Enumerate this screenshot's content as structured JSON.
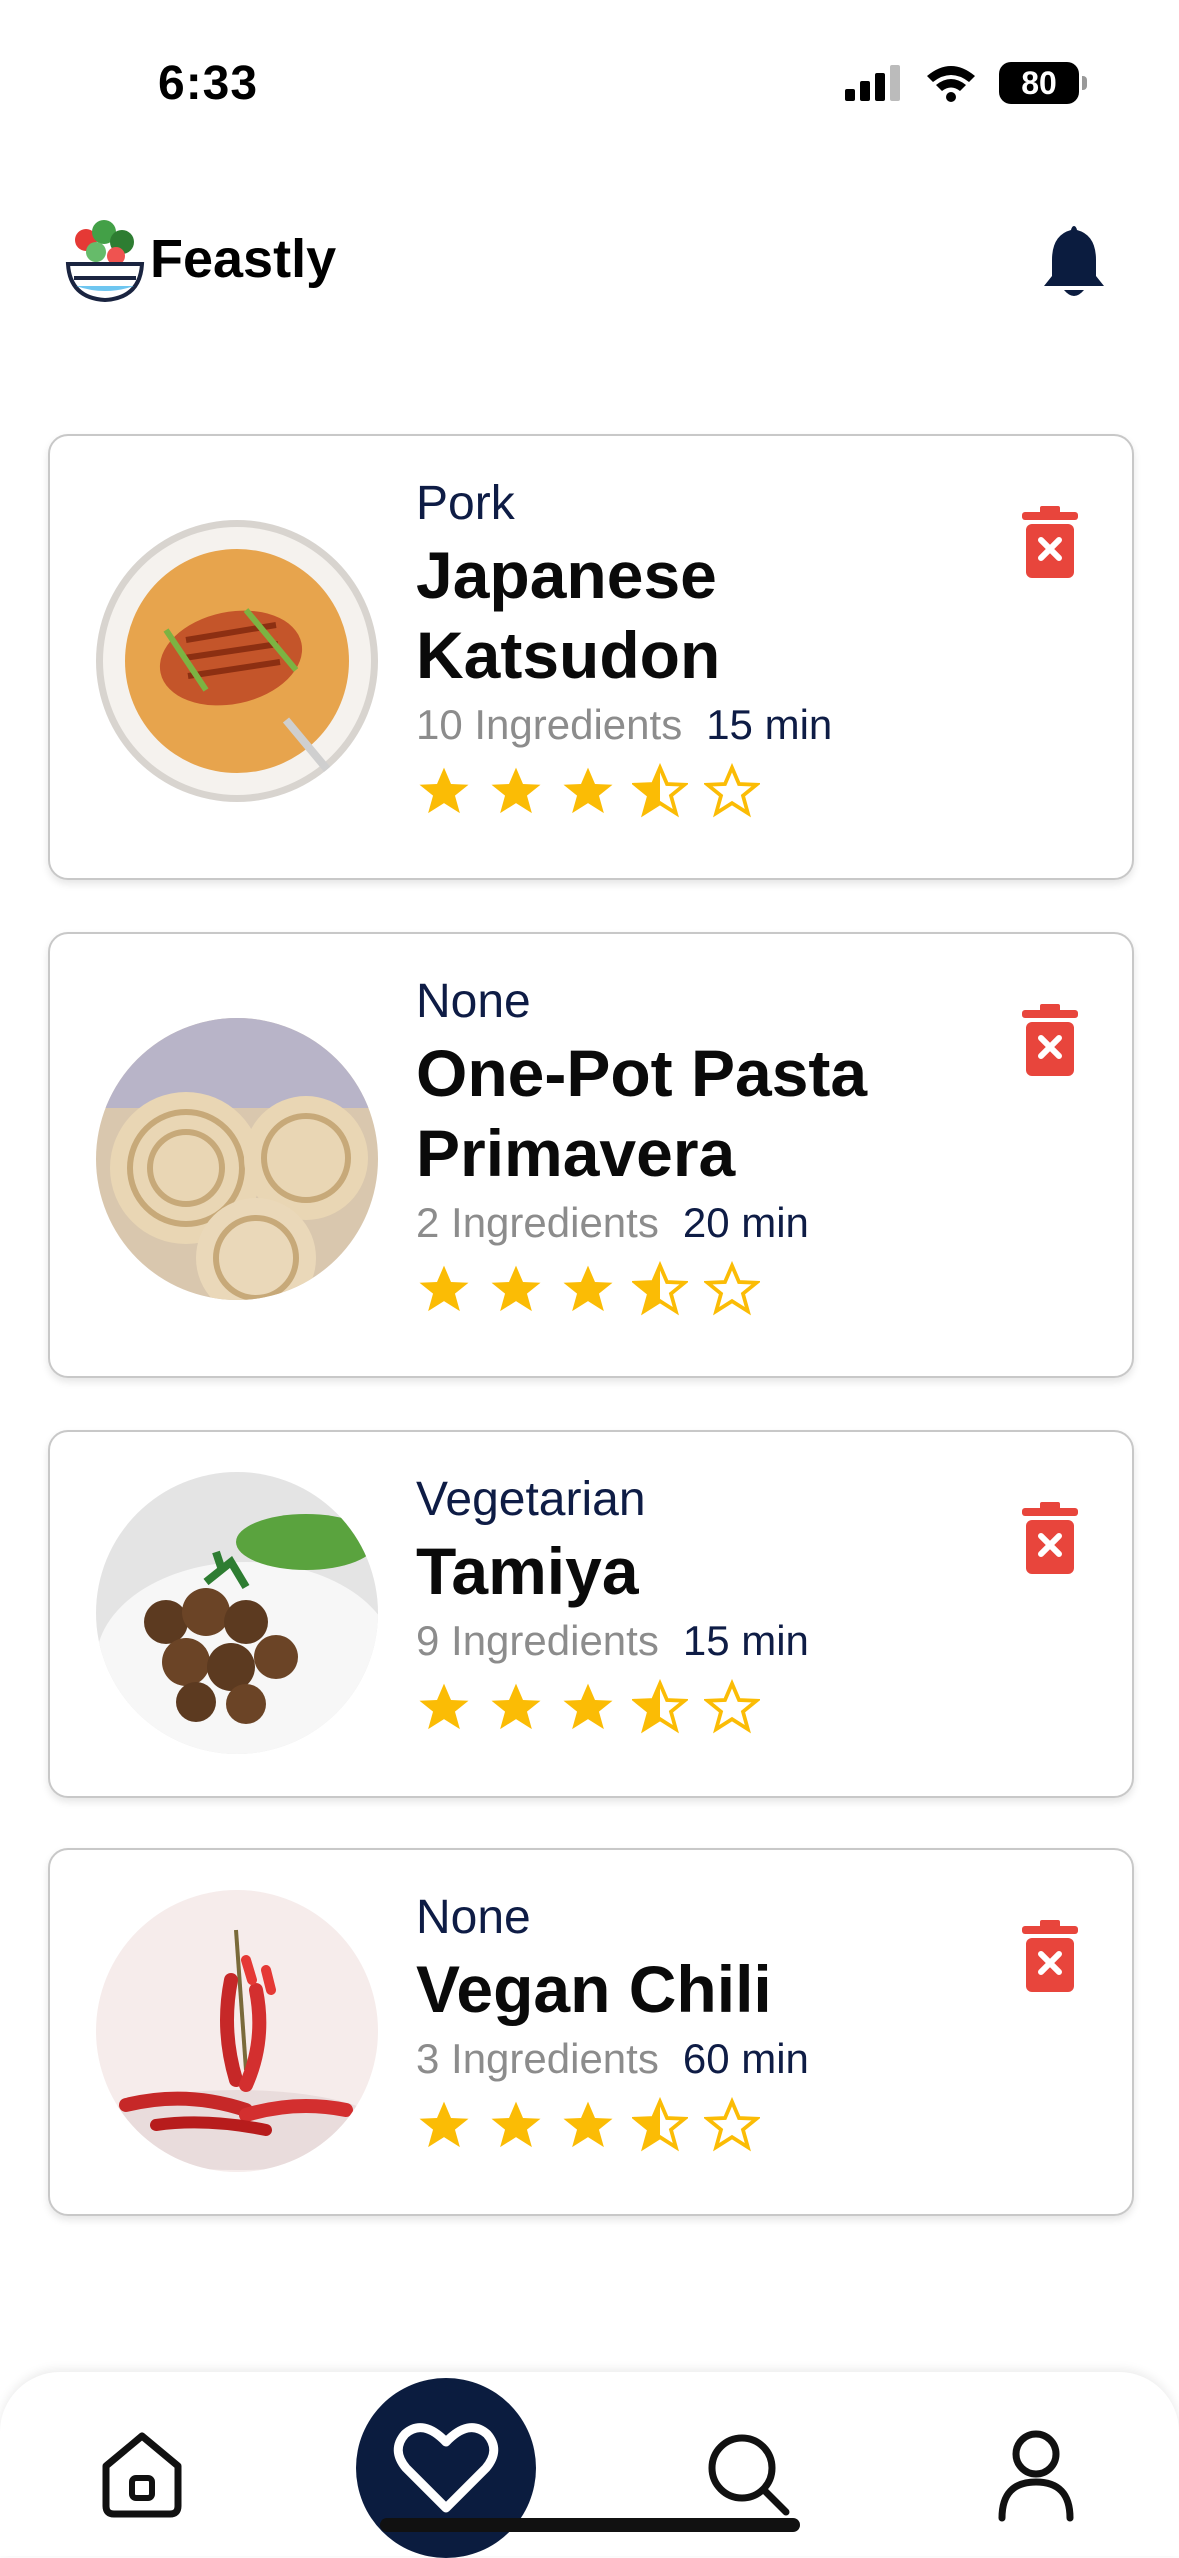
{
  "status_bar": {
    "time": "6:33",
    "battery": "80"
  },
  "header": {
    "brand": "Feastly"
  },
  "recipes": [
    {
      "category": "Pork",
      "title": "Japanese Katsudon",
      "ingredients": "10 Ingredients",
      "time": "15 min",
      "rating": 3.5
    },
    {
      "category": "None",
      "title": "One-Pot Pasta Primavera",
      "ingredients": "2 Ingredients",
      "time": "20 min",
      "rating": 3.5
    },
    {
      "category": "Vegetarian",
      "title": "Tamiya",
      "ingredients": "9 Ingredients",
      "time": "15 min",
      "rating": 3.5
    },
    {
      "category": "None",
      "title": "Vegan Chili",
      "ingredients": "3 Ingredients",
      "time": "60 min",
      "rating": 3.5
    }
  ],
  "bottom_nav": {
    "items": [
      {
        "icon": "home-icon"
      },
      {
        "icon": "heart-icon",
        "active": true
      },
      {
        "icon": "search-icon"
      },
      {
        "icon": "user-icon"
      }
    ]
  },
  "colors": {
    "accent": "#0b1c3f",
    "star": "#fbbc05",
    "delete": "#e8453c",
    "muted": "#8c8c8c"
  }
}
